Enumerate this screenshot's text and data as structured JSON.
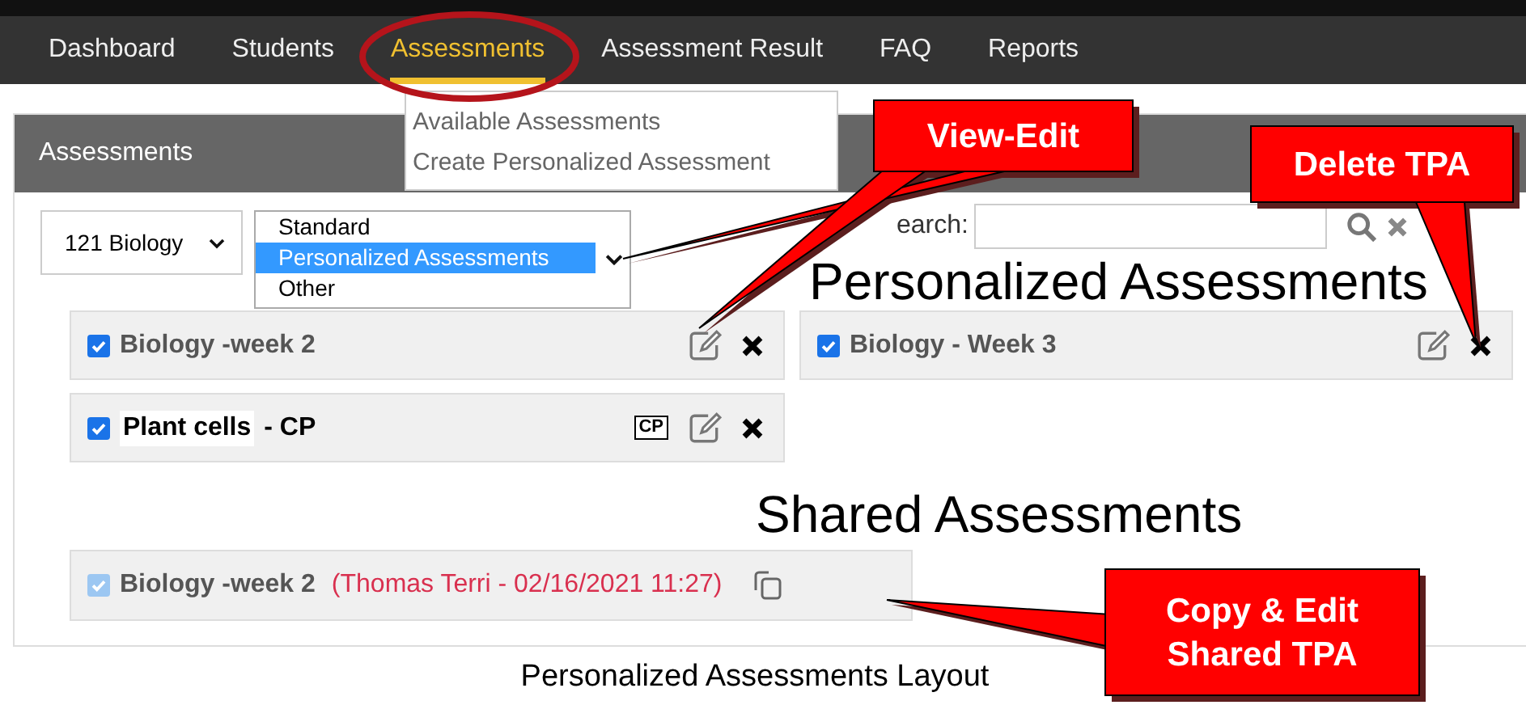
{
  "nav": {
    "items": [
      {
        "label": "Dashboard",
        "selected": false
      },
      {
        "label": "Students",
        "selected": false
      },
      {
        "label": "Assessments",
        "selected": true
      },
      {
        "label": "Assessment Result",
        "selected": false
      },
      {
        "label": "FAQ",
        "selected": false
      },
      {
        "label": "Reports",
        "selected": false
      }
    ]
  },
  "dropdown_menu": {
    "items": [
      "Available Assessments",
      "Create Personalized Assessment"
    ]
  },
  "panel": {
    "title": "Assessments"
  },
  "course_select": {
    "value": "121 Biology"
  },
  "type_list": {
    "options": [
      {
        "label": "Standard",
        "selected": false
      },
      {
        "label": "Personalized Assessments",
        "selected": true
      },
      {
        "label": "Other",
        "selected": false
      }
    ]
  },
  "search": {
    "label": "earch:"
  },
  "personalized": {
    "heading": "Personalized Assessments",
    "items": [
      {
        "title": "Biology -week 2",
        "checked": true
      },
      {
        "title": "Plant cells",
        "suffix": "- CP",
        "badge": "CP",
        "checked": true
      },
      {
        "title": "Biology - Week 3",
        "checked": true
      }
    ]
  },
  "shared": {
    "heading": "Shared Assessments",
    "items": [
      {
        "title": "Biology -week 2",
        "checked": true,
        "disabled": true,
        "author": "(Thomas Terri - 02/16/2021 11:27)"
      }
    ]
  },
  "annotations": [
    {
      "kind": "ellipse"
    },
    {
      "kind": "callout",
      "lines": [
        "View-Edit"
      ]
    },
    {
      "kind": "callout",
      "lines": [
        "Delete TPA"
      ]
    },
    {
      "kind": "callout",
      "lines": [
        "Copy & Edit",
        "Shared TPA"
      ]
    }
  ],
  "caption": "Personalized Assessments Layout"
}
